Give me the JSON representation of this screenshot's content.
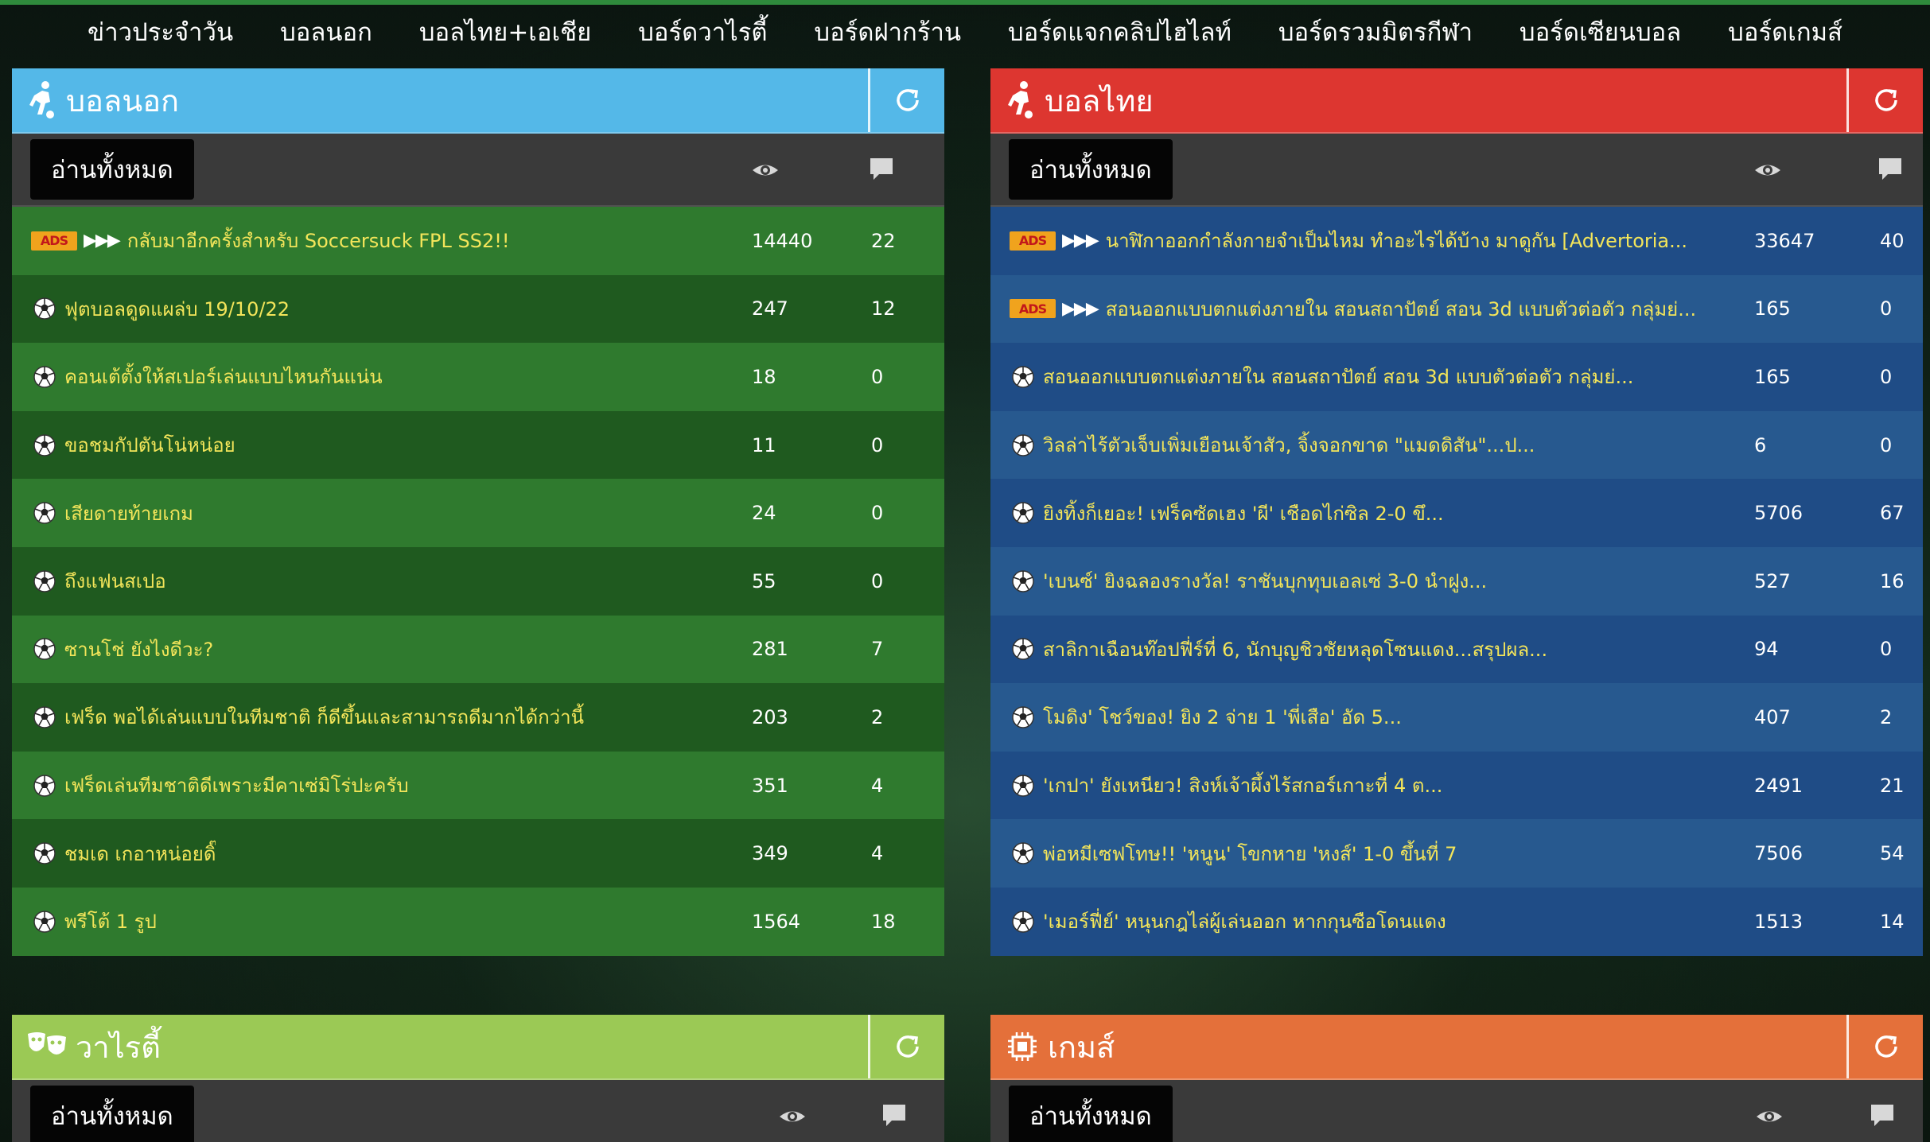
{
  "nav": [
    "ข่าวประจำวัน",
    "บอลนอก",
    "บอลไทย+เอเชีย",
    "บอร์ดวาไรตี้",
    "บอร์ดฝากร้าน",
    "บอร์ดแจกคลิปไฮไลท์",
    "บอร์ดรวมมิตรกีฬา",
    "บอร์ดเซียนบอล",
    "บอร์ดเกมส์"
  ],
  "read_all_label": "อ่านทั้งหมด",
  "ads_label": "ADS",
  "arrows": "▶▶▶",
  "colors": {
    "foreign_header": "#54b8e8",
    "thai_header": "#dd3630",
    "variety_header": "#9bc955",
    "games_header": "#e4703a",
    "title_text": "#f3e55a"
  },
  "panels": {
    "foreign": {
      "title": "บอลนอก",
      "rows": [
        {
          "ads": true,
          "title": "กลับมาอีกครั้งสำหรับ Soccersuck FPL SS2!!",
          "views": "14440",
          "comments": "22"
        },
        {
          "ads": false,
          "title": "ฟุตบอลดูดแผล่บ 19/10/22",
          "views": "247",
          "comments": "12"
        },
        {
          "ads": false,
          "title": "คอนเต้ตั้งให้สเปอร์เล่นแบบไหนกันแน่น",
          "views": "18",
          "comments": "0"
        },
        {
          "ads": false,
          "title": "ขอชมกัปตันโน่หน่อย",
          "views": "11",
          "comments": "0"
        },
        {
          "ads": false,
          "title": "เสียดายท้ายเกม",
          "views": "24",
          "comments": "0"
        },
        {
          "ads": false,
          "title": "ถึงแฟนสเปอ",
          "views": "55",
          "comments": "0"
        },
        {
          "ads": false,
          "title": "ซานโช่ ยังไงดีวะ?",
          "views": "281",
          "comments": "7"
        },
        {
          "ads": false,
          "title": "เฟร็ด พอได้เล่นแบบในทีมชาติ ก็ดีขึ้นและสามารถดีมากได้กว่านี้",
          "views": "203",
          "comments": "2"
        },
        {
          "ads": false,
          "title": "เฟร็ดเล่นทีมชาติดีเพราะมีคาเซ่มิโร่ปะครับ",
          "views": "351",
          "comments": "4"
        },
        {
          "ads": false,
          "title": "ชมเด เกอาหน่อยดิ๊",
          "views": "349",
          "comments": "4"
        },
        {
          "ads": false,
          "title": "พรีโต้ 1 รูป",
          "views": "1564",
          "comments": "18"
        }
      ]
    },
    "thai": {
      "title": "บอลไทย",
      "rows": [
        {
          "ads": true,
          "title": "นาฬิกาออกกำลังกายจำเป็นไหม ทำอะไรได้บ้าง มาดูกัน [Advertoria...",
          "views": "33647",
          "comments": "40"
        },
        {
          "ads": true,
          "title": "สอนออกแบบตกแต่งภายใน สอนสถาปัตย์ สอน 3d แบบตัวต่อตัว กลุ่มย่...",
          "views": "165",
          "comments": "0"
        },
        {
          "ads": false,
          "title": "สอนออกแบบตกแต่งภายใน สอนสถาปัตย์ สอน 3d แบบตัวต่อตัว กลุ่มย่...",
          "views": "165",
          "comments": "0"
        },
        {
          "ads": false,
          "title": "วิลล่าไร้ตัวเจ็บเพิ่มเยือนเจ้าสัว, จิ้งจอกขาด \"แมดดิสัน\"...ป...",
          "views": "6",
          "comments": "0"
        },
        {
          "ads": false,
          "title": "ยิงทิ้งก็เยอะ! เฟร็คซัดเฮง 'ผี' เชือดไก่ซิล 2-0 ขึ...",
          "views": "5706",
          "comments": "67"
        },
        {
          "ads": false,
          "title": "'เบนซ์' ยิงฉลองรางวัล! ราชันบุกทุบเอลเซ่ 3-0 นำฝูง...",
          "views": "527",
          "comments": "16"
        },
        {
          "ads": false,
          "title": "สาลิกาเฉือนท๊อปฟี่ร์ที่ 6, นักบุญชิวชัยหลุดโซนแดง...สรุปผล...",
          "views": "94",
          "comments": "0"
        },
        {
          "ads": false,
          "title": "โมดิง' โชว์ของ! ยิง 2 จ่าย 1 'พี่เสือ' อัด 5...",
          "views": "407",
          "comments": "2"
        },
        {
          "ads": false,
          "title": "'เกปา' ยังเหนียว! สิงห์เจ้าผึ้งไร้สกอร์เกาะที่ 4 ต...",
          "views": "2491",
          "comments": "21"
        },
        {
          "ads": false,
          "title": "พ่อหมีเซฟโทษ!! 'หนูน' โขกหาย 'หงส์' 1-0 ขึ้นที่ 7",
          "views": "7506",
          "comments": "54"
        },
        {
          "ads": false,
          "title": "'เมอร์ฟี่ย์' หนุนกฎไล่ผู้เล่นออก หากกุนซือโดนแดง",
          "views": "1513",
          "comments": "14"
        }
      ]
    },
    "variety": {
      "title": "วาไรตี้"
    },
    "games": {
      "title": "เกมส์"
    }
  }
}
